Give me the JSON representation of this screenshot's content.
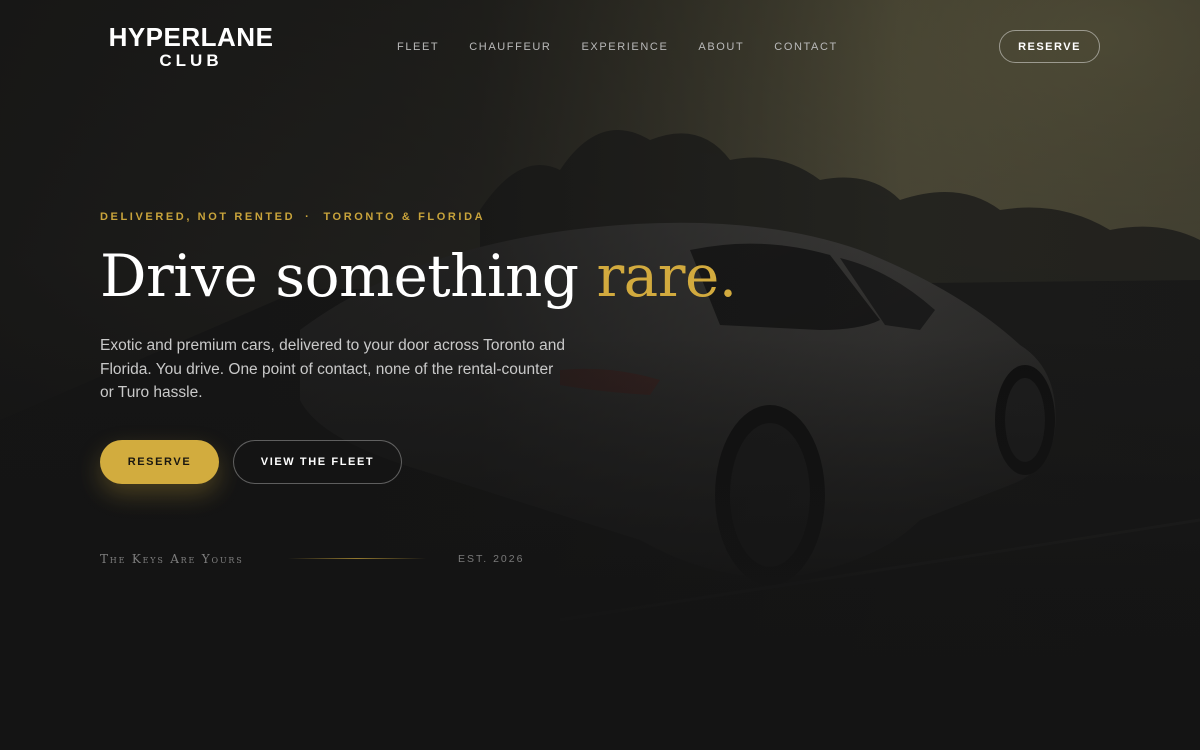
{
  "brand": {
    "line1": "HYPERLANE",
    "line2": "CLUB"
  },
  "nav": {
    "items": [
      {
        "label": "FLEET"
      },
      {
        "label": "CHAUFFEUR"
      },
      {
        "label": "EXPERIENCE"
      },
      {
        "label": "ABOUT"
      },
      {
        "label": "CONTACT"
      }
    ],
    "reserve_label": "RESERVE"
  },
  "hero": {
    "eyebrow_left": "DELIVERED, NOT RENTED",
    "eyebrow_sep": "·",
    "eyebrow_right": "TORONTO & FLORIDA",
    "title_main": "Drive something",
    "title_accent": "rare.",
    "lead": "Exotic and premium cars, delivered to your door across Toronto and Florida. You drive. One point of contact, none of the rental-counter or Turo hassle.",
    "primary_button": "RESERVE",
    "secondary_button": "VIEW THE FLEET",
    "tagline": "The Keys Are Yours",
    "established": "EST. 2026"
  },
  "colors": {
    "background": "#141414",
    "accent_gold": "#d2ac3e",
    "eyebrow_gold": "#c9a43b",
    "text_muted": "#c9c9c9"
  }
}
